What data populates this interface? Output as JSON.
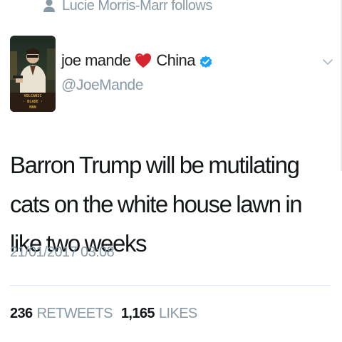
{
  "social_context": {
    "text": "Lucie Morris-Marr follows",
    "icon": "person-icon"
  },
  "author": {
    "name_first": "joe mande",
    "heart_icon": "red-heart-icon",
    "name_second": "China",
    "verified_icon": "verified-badge-icon",
    "handle": "@JoeMande",
    "avatar_lettering": "VOLCANIC BLADE MAN"
  },
  "tweet": {
    "text": "Barron Trump will be mutilating cats on the white house lawn in like two weeks",
    "timestamp": "21/01/2017 03:08"
  },
  "stats": {
    "retweets_count": "236",
    "retweets_label": "RETWEETS",
    "likes_count": "1,165",
    "likes_label": "LIKES"
  },
  "colors": {
    "text_primary": "#14171a",
    "text_secondary": "#8899a6",
    "heart": "#e0245e",
    "verified": "#1da1f2",
    "divider": "#e1e8ed"
  },
  "menu_icon": "chevron-down-icon"
}
